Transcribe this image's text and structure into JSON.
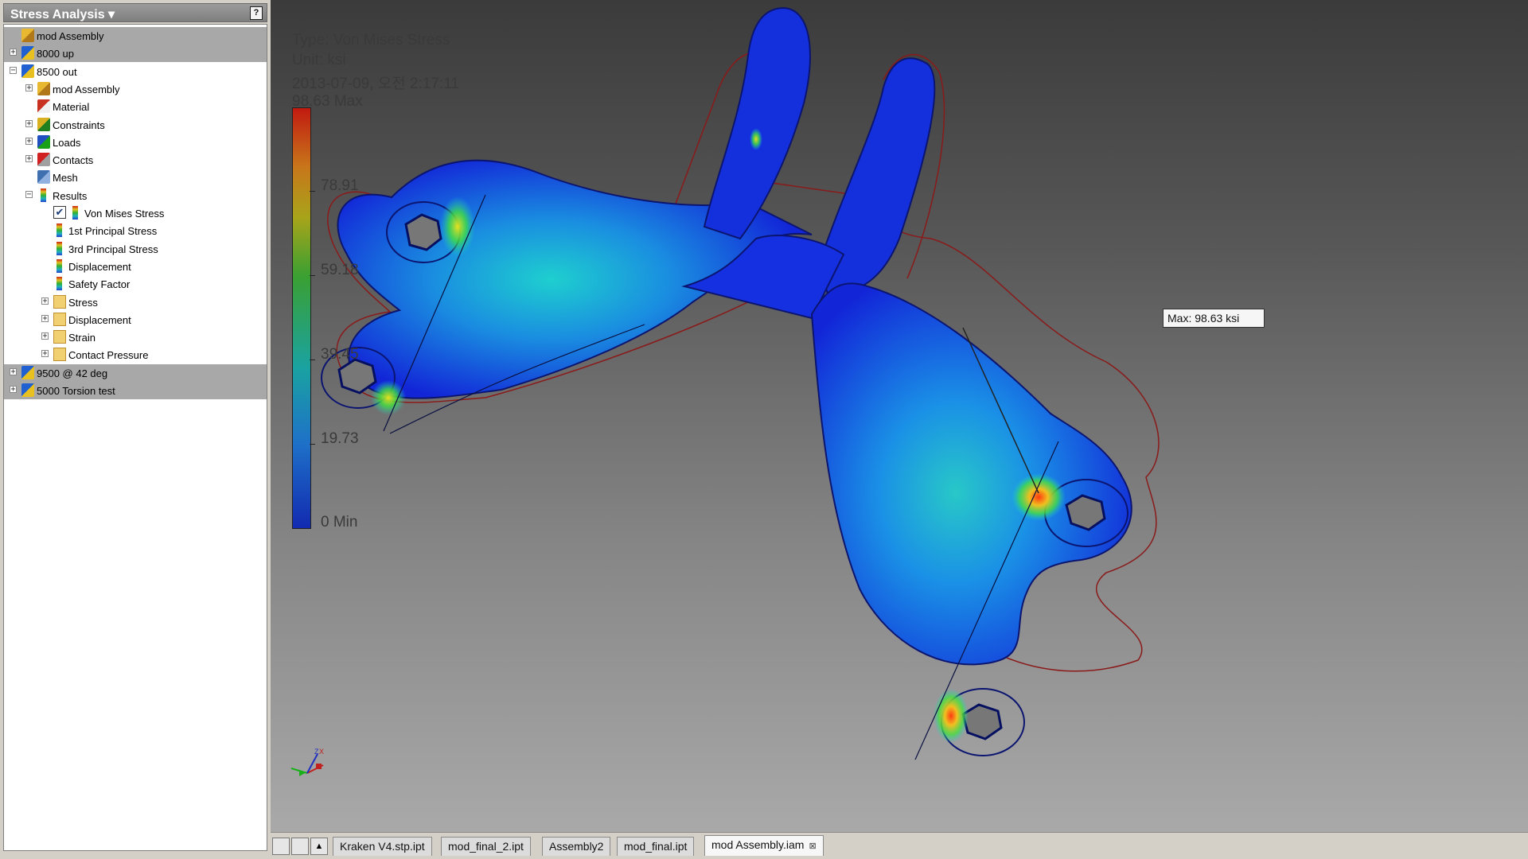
{
  "panel": {
    "title": "Stress Analysis ▾",
    "help_label": "?",
    "tree": [
      {
        "label": "mod Assembly",
        "icon": "assembly-icon",
        "level": 0,
        "exp": "",
        "gray": true
      },
      {
        "label": "8000 up",
        "icon": "simulation-icon",
        "level": 0,
        "exp": "+",
        "gray": true
      },
      {
        "label": "8500 out",
        "icon": "simulation-icon",
        "level": 0,
        "exp": "−",
        "gray": false
      },
      {
        "label": "mod Assembly",
        "icon": "assembly-icon",
        "level": 1,
        "exp": "+",
        "gray": false
      },
      {
        "label": "Material",
        "icon": "material-icon",
        "level": 1,
        "exp": "",
        "gray": false
      },
      {
        "label": "Constraints",
        "icon": "constraints-icon",
        "level": 1,
        "exp": "+",
        "gray": false
      },
      {
        "label": "Loads",
        "icon": "loads-icon",
        "level": 1,
        "exp": "+",
        "gray": false
      },
      {
        "label": "Contacts",
        "icon": "contacts-icon",
        "level": 1,
        "exp": "+",
        "gray": false
      },
      {
        "label": "Mesh",
        "icon": "mesh-icon",
        "level": 1,
        "exp": "",
        "gray": false
      },
      {
        "label": "Results",
        "icon": "results-icon",
        "level": 1,
        "exp": "−",
        "gray": false
      },
      {
        "label": "Von Mises Stress",
        "icon": "results-icon",
        "level": 2,
        "exp": "",
        "gray": false,
        "checked": true
      },
      {
        "label": "1st Principal Stress",
        "icon": "results-icon",
        "level": 2,
        "exp": "",
        "gray": false
      },
      {
        "label": "3rd Principal Stress",
        "icon": "results-icon",
        "level": 2,
        "exp": "",
        "gray": false
      },
      {
        "label": "Displacement",
        "icon": "results-icon",
        "level": 2,
        "exp": "",
        "gray": false
      },
      {
        "label": "Safety Factor",
        "icon": "results-icon",
        "level": 2,
        "exp": "",
        "gray": false
      },
      {
        "label": "Stress",
        "icon": "folder-icon",
        "level": 2,
        "exp": "+",
        "gray": false
      },
      {
        "label": "Displacement",
        "icon": "folder-icon",
        "level": 2,
        "exp": "+",
        "gray": false
      },
      {
        "label": "Strain",
        "icon": "folder-icon",
        "level": 2,
        "exp": "+",
        "gray": false
      },
      {
        "label": "Contact Pressure",
        "icon": "folder-icon",
        "level": 2,
        "exp": "+",
        "gray": false
      },
      {
        "label": "9500 @ 42 deg",
        "icon": "simulation-icon",
        "level": 0,
        "exp": "+",
        "gray": true
      },
      {
        "label": "5000 Torsion test",
        "icon": "simulation-icon",
        "level": 0,
        "exp": "+",
        "gray": true
      }
    ]
  },
  "viewport": {
    "type_text": "Type: Von Mises Stress",
    "unit_text": "Unit: ksi",
    "date_text": "2013-07-09, 오전 2:17:11",
    "legend": {
      "max": "98.63 Max",
      "t1": "78.91",
      "t2": "59.18",
      "t3": "39.45",
      "t4": "19.73",
      "min": "0 Min"
    },
    "probe_label": "Max: 98.63 ksi"
  },
  "tabs": [
    {
      "label": "Kraken V4.stp.ipt",
      "active": false
    },
    {
      "label": "mod_final_2.ipt",
      "active": false
    },
    {
      "label": "Assembly2",
      "active": false
    },
    {
      "label": "mod_final.ipt",
      "active": false
    },
    {
      "label": "mod Assembly.iam",
      "active": true
    }
  ],
  "tab_close_glyph": "⊠",
  "colors": {
    "stress_max": "#c11a10",
    "stress_min": "#122ab0",
    "panel_gray": "#a8a8a8"
  }
}
